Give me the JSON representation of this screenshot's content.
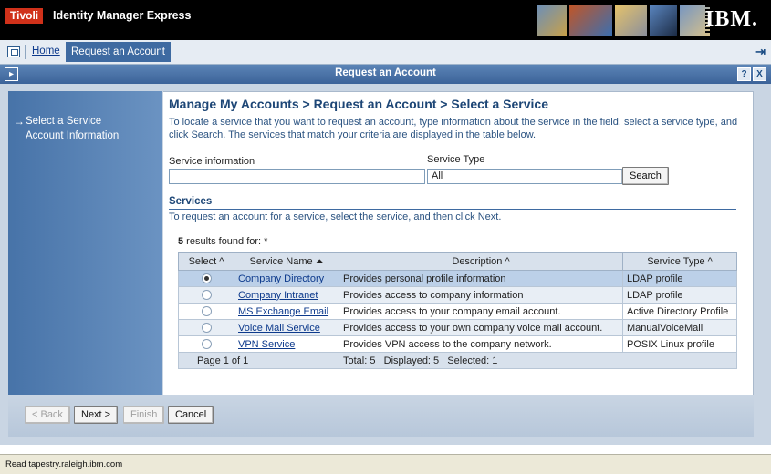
{
  "banner": {
    "brand": "Tivoli",
    "product": "Identity Manager Express",
    "logo": "IBM."
  },
  "tabs": {
    "home": "Home",
    "active": "Request an Account"
  },
  "titlebar": {
    "title": "Request an Account",
    "help": "?",
    "close": "X"
  },
  "nav": {
    "items": [
      {
        "label": "Select a Service",
        "current": true
      },
      {
        "label": "Account Information",
        "current": false
      }
    ]
  },
  "main": {
    "title": "Manage My Accounts > Request an Account > Select a Service",
    "intro": "To locate a service that you want to request an account, type information about the service in the field, select a service type, and click Search. The services that match your criteria are displayed in the table below.",
    "service_info_label": "Service information",
    "service_info_value": "",
    "service_type_label": "Service Type",
    "service_type_value": "All",
    "search_button": "Search",
    "services_heading": "Services",
    "services_desc": "To request an account for a service, select the service, and then click Next.",
    "results_count": "5",
    "results_suffix": " results found for: *"
  },
  "table": {
    "headers": {
      "select": "Select ^",
      "name": "Service Name ⏶",
      "description": "Description ^",
      "type": "Service Type ^"
    },
    "rows": [
      {
        "name": "Company Directory",
        "description": "Provides personal profile information",
        "type": "LDAP profile",
        "selected": true
      },
      {
        "name": "Company Intranet",
        "description": "Provides access to company information",
        "type": "LDAP profile",
        "selected": false
      },
      {
        "name": "MS Exchange Email",
        "description": "Provides access to your company email account.",
        "type": "Active Directory Profile",
        "selected": false
      },
      {
        "name": "Voice Mail Service",
        "description": "Provides access to your own company voice mail account.",
        "type": "ManualVoiceMail",
        "selected": false
      },
      {
        "name": "VPN Service",
        "description": "Provides VPN access to the company network.",
        "type": "POSIX Linux profile",
        "selected": false
      }
    ],
    "footer_page": "Page 1 of 1",
    "footer_totals": "Total: 5   Displayed: 5   Selected: 1"
  },
  "wizard": {
    "back": "< Back",
    "next": "Next >",
    "finish": "Finish",
    "cancel": "Cancel"
  },
  "status": {
    "text": "Read tapestry.raleigh.ibm.com"
  },
  "colors": {
    "titlebar": "#3c6399",
    "nav": "#4773a8",
    "selected_row": "#bcd0e8",
    "tivoli_red": "#d0311a"
  },
  "icons": [
    "tab-window-icon",
    "exit-icon",
    "collapse-icon",
    "arrow-right-icon",
    "radio-icon",
    "dropdown-arrow-icon"
  ]
}
